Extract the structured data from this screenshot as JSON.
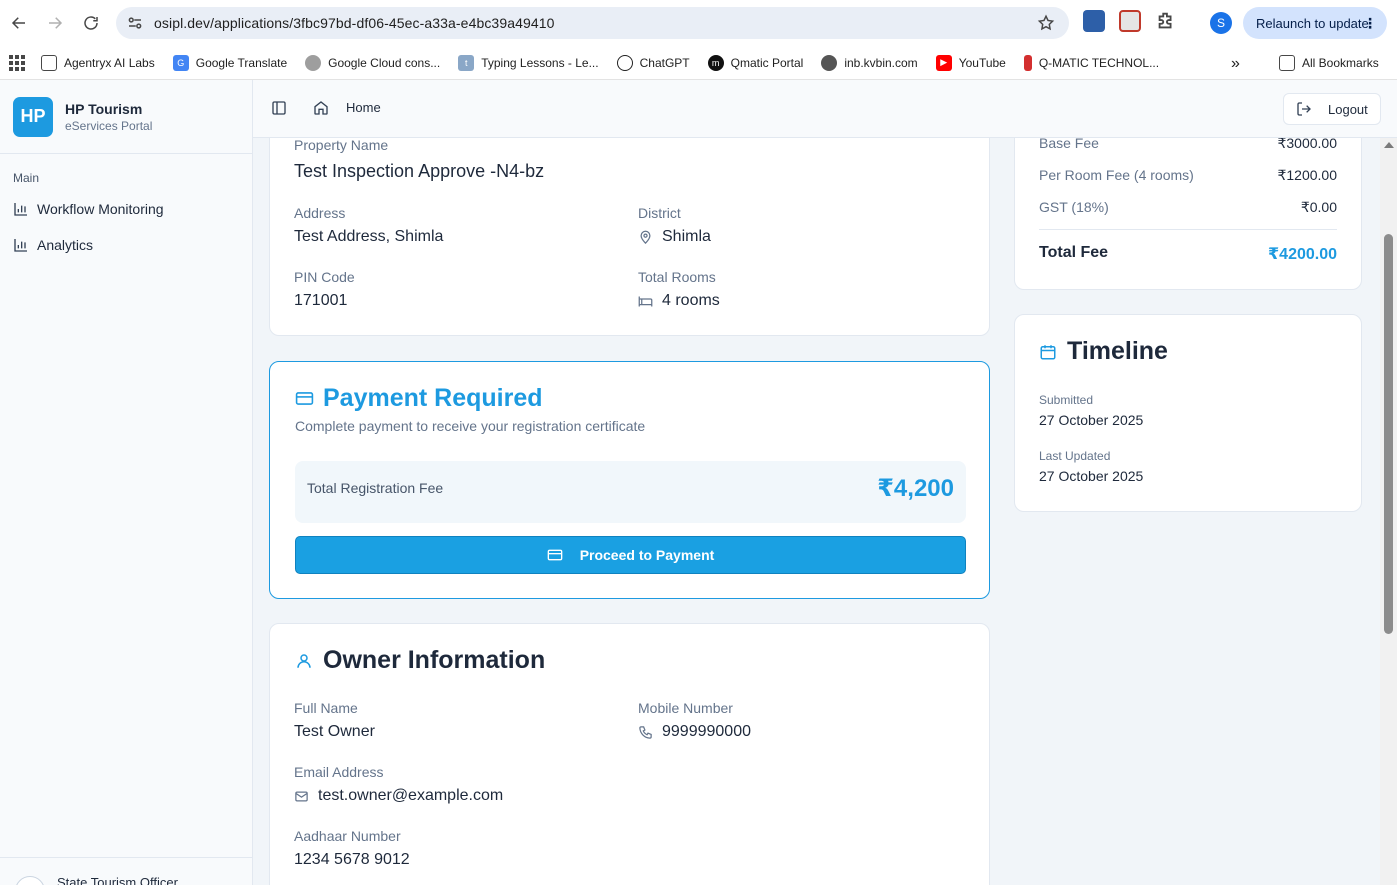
{
  "browser": {
    "url": "osipl.dev/applications/3fbc97bd-df06-45ec-a33a-e4bc39a49410",
    "profile_initial": "S",
    "relaunch_label": "Relaunch to update",
    "bookmarks": [
      {
        "label": "Agentryx AI Labs",
        "icon": "folder-icon"
      },
      {
        "label": "Google Translate",
        "icon": "google-translate-icon"
      },
      {
        "label": "Google Cloud cons...",
        "icon": "google-cloud-icon"
      },
      {
        "label": "Typing Lessons - Le...",
        "icon": "typing-icon"
      },
      {
        "label": "ChatGPT",
        "icon": "chatgpt-icon"
      },
      {
        "label": "Qmatic Portal",
        "icon": "qmatic-icon"
      },
      {
        "label": "inb.kvbin.com",
        "icon": "globe-icon"
      },
      {
        "label": "YouTube",
        "icon": "youtube-icon"
      },
      {
        "label": "Q-MATIC TECHNOL...",
        "icon": "qmatic-tech-icon"
      }
    ],
    "overflow_label": "»",
    "all_bookmarks_label": "All Bookmarks"
  },
  "sidebar": {
    "brand_initials": "HP",
    "brand_title": "HP Tourism",
    "brand_subtitle": "eServices Portal",
    "group_label": "Main",
    "items": [
      {
        "label": "Workflow Monitoring",
        "icon": "bar-chart-icon"
      },
      {
        "label": "Analytics",
        "icon": "bar-chart-icon"
      }
    ],
    "footer_user": "State Tourism Officer"
  },
  "header": {
    "breadcrumb": "Home",
    "logout_label": "Logout"
  },
  "property": {
    "name_label": "Property Name",
    "name_value": "Test Inspection Approve -N4-bz",
    "address_label": "Address",
    "address_value": "Test Address, Shimla",
    "district_label": "District",
    "district_value": "Shimla",
    "pin_label": "PIN Code",
    "pin_value": "171001",
    "rooms_label": "Total Rooms",
    "rooms_value": "4 rooms"
  },
  "payment": {
    "title": "Payment Required",
    "description": "Complete payment to receive your registration certificate",
    "fee_label": "Total Registration Fee",
    "fee_amount": "₹4,200",
    "button_label": "Proceed to Payment",
    "accent": "#1d9ae0"
  },
  "owner": {
    "title": "Owner Information",
    "full_name_label": "Full Name",
    "full_name_value": "Test Owner",
    "mobile_label": "Mobile Number",
    "mobile_value": "9999990000",
    "email_label": "Email Address",
    "email_value": "test.owner@example.com",
    "aadhaar_label": "Aadhaar Number",
    "aadhaar_value": "1234 5678 9012"
  },
  "fees": {
    "rows": [
      {
        "label": "Base Fee",
        "amount": "₹3000.00"
      },
      {
        "label": "Per Room Fee (4 rooms)",
        "amount": "₹1200.00"
      },
      {
        "label": "GST (18%)",
        "amount": "₹0.00"
      }
    ],
    "total_label": "Total Fee",
    "total_amount": "₹4200.00"
  },
  "timeline": {
    "title": "Timeline",
    "submitted_label": "Submitted",
    "submitted_value": "27 October 2025",
    "updated_label": "Last Updated",
    "updated_value": "27 October 2025"
  }
}
